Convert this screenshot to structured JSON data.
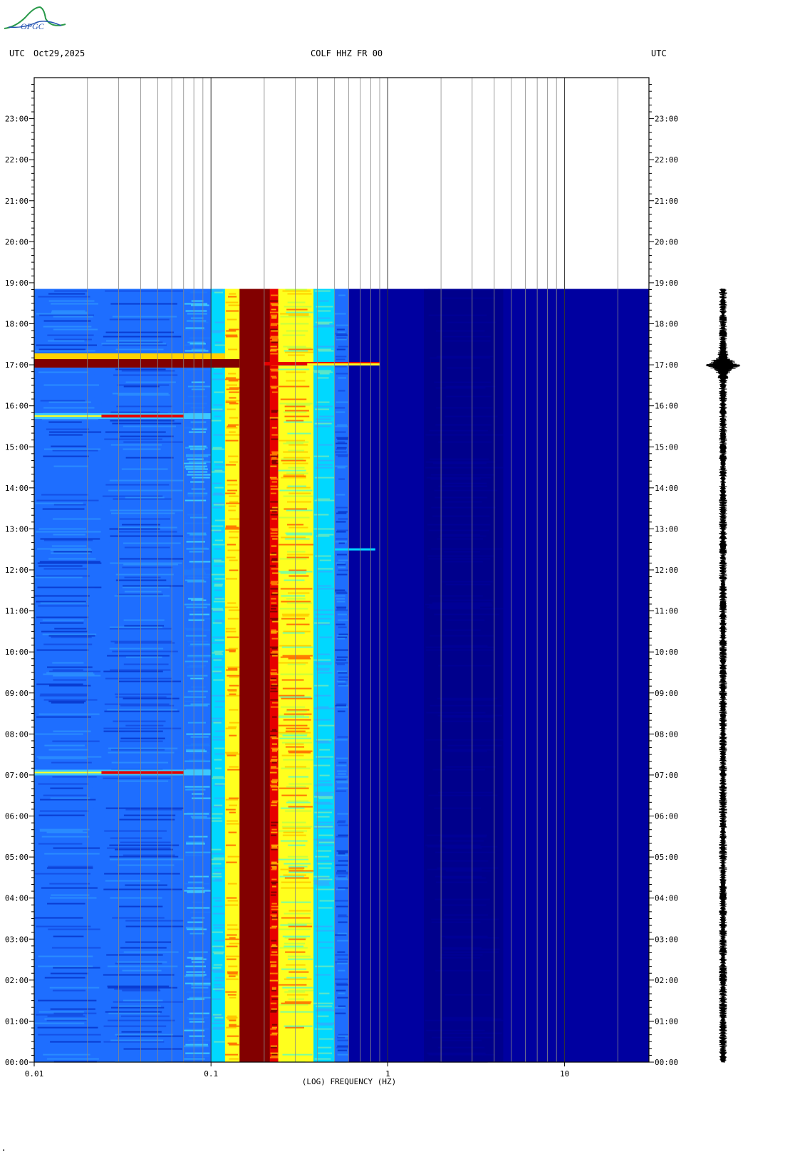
{
  "header": {
    "left_tz": "UTC",
    "date": "Oct29,2025",
    "station": "COLF HHZ FR 00",
    "right_tz": "UTC"
  },
  "logo": {
    "text": "OPGC"
  },
  "colors": {
    "background_fill": "#0000a0",
    "deep_blue": "#00008c",
    "low_noise": "#1e6eff",
    "cyan": "#00d8ff",
    "yellow": "#ffff1e",
    "orange": "#ff7800",
    "red": "#e60000",
    "dark_red": "#820000",
    "grid": "#888888"
  },
  "chart_data": {
    "type": "heatmap",
    "title": "",
    "xlabel": "(LOG) FREQUENCY (HZ)",
    "ylabel": "",
    "x_scale": "log",
    "xlim": [
      0.01,
      30
    ],
    "x_ticks": [
      {
        "value": 0.01,
        "label": "0.01"
      },
      {
        "value": 0.1,
        "label": "0.1"
      },
      {
        "value": 1,
        "label": "1"
      },
      {
        "value": 10,
        "label": "10"
      }
    ],
    "x_gridlines": [
      0.02,
      0.03,
      0.04,
      0.05,
      0.06,
      0.07,
      0.08,
      0.09,
      0.1,
      0.2,
      0.3,
      0.4,
      0.5,
      0.6,
      0.7,
      0.8,
      0.9,
      1,
      2,
      3,
      4,
      5,
      6,
      7,
      8,
      9,
      10,
      20
    ],
    "ylim_hours": [
      0,
      24
    ],
    "y_ticks": [
      {
        "value": 0,
        "label": "00:00"
      },
      {
        "value": 1,
        "label": "01:00"
      },
      {
        "value": 2,
        "label": "02:00"
      },
      {
        "value": 3,
        "label": "03:00"
      },
      {
        "value": 4,
        "label": "04:00"
      },
      {
        "value": 5,
        "label": "05:00"
      },
      {
        "value": 6,
        "label": "06:00"
      },
      {
        "value": 7,
        "label": "07:00"
      },
      {
        "value": 8,
        "label": "08:00"
      },
      {
        "value": 9,
        "label": "09:00"
      },
      {
        "value": 10,
        "label": "10:00"
      },
      {
        "value": 11,
        "label": "11:00"
      },
      {
        "value": 12,
        "label": "12:00"
      },
      {
        "value": 13,
        "label": "13:00"
      },
      {
        "value": 14,
        "label": "14:00"
      },
      {
        "value": 15,
        "label": "15:00"
      },
      {
        "value": 16,
        "label": "16:00"
      },
      {
        "value": 17,
        "label": "17:00"
      },
      {
        "value": 18,
        "label": "18:00"
      },
      {
        "value": 19,
        "label": "19:00"
      },
      {
        "value": 20,
        "label": "20:00"
      },
      {
        "value": 21,
        "label": "21:00"
      },
      {
        "value": 22,
        "label": "22:00"
      },
      {
        "value": 23,
        "label": "23:00"
      }
    ],
    "data_end_hour": 18.85,
    "frequency_bands": [
      {
        "f0": 0.01,
        "f1": 0.024,
        "level": "low_noise"
      },
      {
        "f0": 0.024,
        "f1": 0.07,
        "level": "low_noise"
      },
      {
        "f0": 0.07,
        "f1": 0.1,
        "level": "low_noise_to_cyan"
      },
      {
        "f0": 0.1,
        "f1": 0.12,
        "level": "cyan"
      },
      {
        "f0": 0.12,
        "f1": 0.145,
        "level": "yellow_orange"
      },
      {
        "f0": 0.145,
        "f1": 0.215,
        "level": "dark_red"
      },
      {
        "f0": 0.215,
        "f1": 0.24,
        "level": "red_orange"
      },
      {
        "f0": 0.24,
        "f1": 0.38,
        "level": "yellow"
      },
      {
        "f0": 0.38,
        "f1": 0.5,
        "level": "cyan"
      },
      {
        "f0": 0.5,
        "f1": 0.6,
        "level": "low_noise"
      },
      {
        "f0": 0.6,
        "f1": 1.6,
        "level": "background_fill"
      },
      {
        "f0": 1.6,
        "f1": 4.5,
        "level": "deep_blue"
      },
      {
        "f0": 4.5,
        "f1": 30,
        "level": "background_fill"
      }
    ],
    "events": [
      {
        "hour": 17.0,
        "f_max": 0.9,
        "level": "strong"
      },
      {
        "hour": 15.75,
        "f_max": 0.07,
        "level": "moderate"
      },
      {
        "hour": 7.06,
        "f_max": 0.07,
        "level": "moderate"
      },
      {
        "hour": 12.5,
        "f_max": 0.85,
        "level": "weak"
      },
      {
        "hour": 10.1,
        "f_max": 0.17,
        "level": "weak"
      }
    ],
    "seismogram": {
      "hour_start": 0,
      "hour_end": 18.85,
      "event_hour": 17.0,
      "event_amplitude": 1.0,
      "noise_amplitude": 0.15
    }
  }
}
